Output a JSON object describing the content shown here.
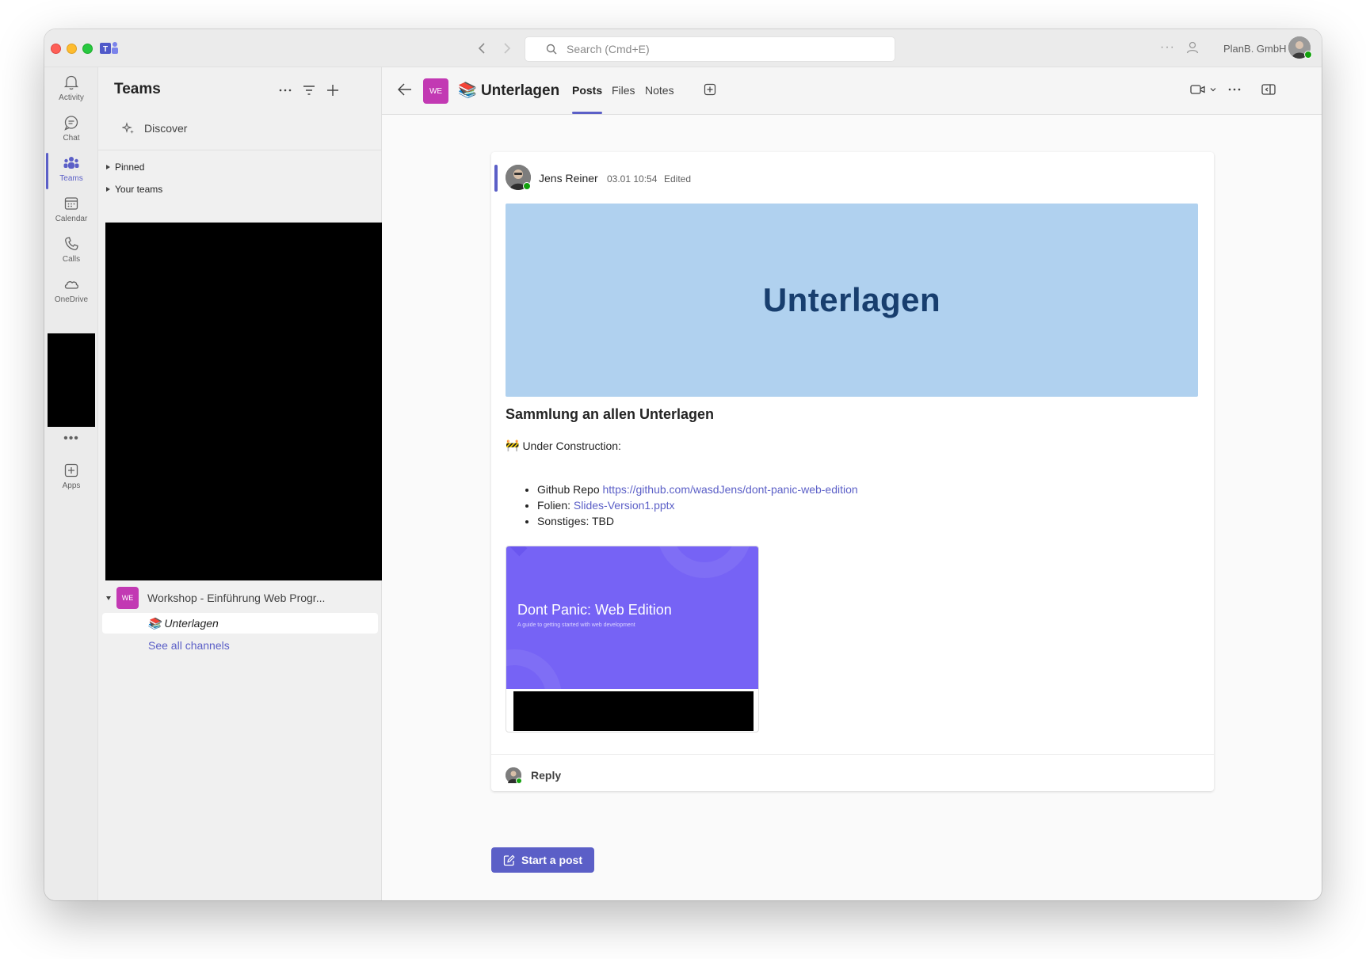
{
  "titlebar": {
    "search_placeholder": "Search (Cmd+E)",
    "org_name": "PlanB. GmbH",
    "more_icon": "ellipsis-icon"
  },
  "rail": {
    "items": [
      {
        "label": "Activity",
        "icon": "bell-icon"
      },
      {
        "label": "Chat",
        "icon": "chat-icon"
      },
      {
        "label": "Teams",
        "icon": "teams-icon",
        "active": true
      },
      {
        "label": "Calendar",
        "icon": "calendar-icon"
      },
      {
        "label": "Calls",
        "icon": "phone-icon"
      },
      {
        "label": "OneDrive",
        "icon": "cloud-icon"
      }
    ],
    "more": "•••",
    "apps_label": "Apps"
  },
  "teams_pane": {
    "title": "Teams",
    "discover": "Discover",
    "pinned": "Pinned",
    "your_teams": "Your teams",
    "team": {
      "badge": "WE",
      "name": "Workshop - Einführung Web Progr..."
    },
    "channel": {
      "emoji": "📚",
      "name": "Unterlagen"
    },
    "see_all": "See all channels"
  },
  "channel_header": {
    "badge": "WE",
    "emoji": "📚",
    "title": "Unterlagen",
    "tabs": [
      {
        "label": "Posts",
        "active": true
      },
      {
        "label": "Files",
        "active": false
      },
      {
        "label": "Notes",
        "active": false
      }
    ]
  },
  "post": {
    "author": "Jens Reiner",
    "timestamp": "03.01 10:54",
    "edited": "Edited",
    "banner_title": "Unterlagen",
    "heading": "Sammlung an allen Unterlagen",
    "construction_emoji": "🚧",
    "construction_text": "Under Construction:",
    "list": [
      {
        "prefix": "Github Repo ",
        "link": "https://github.com/wasdJens/dont-panic-web-edition"
      },
      {
        "prefix": "Folien: ",
        "link": "Slides-Version1.pptx"
      },
      {
        "prefix": "Sonstiges: TBD",
        "link": ""
      }
    ],
    "preview": {
      "title": "Dont Panic: Web Edition",
      "subtitle": "A guide to getting started with web development"
    },
    "reply_label": "Reply"
  },
  "start_post_label": "Start a post",
  "colors": {
    "accent": "#5b5fc7",
    "team_badge": "#c239b3",
    "banner_bg": "#b0d1ef",
    "banner_text": "#183e6e",
    "slide_bg": "#7663f5"
  }
}
